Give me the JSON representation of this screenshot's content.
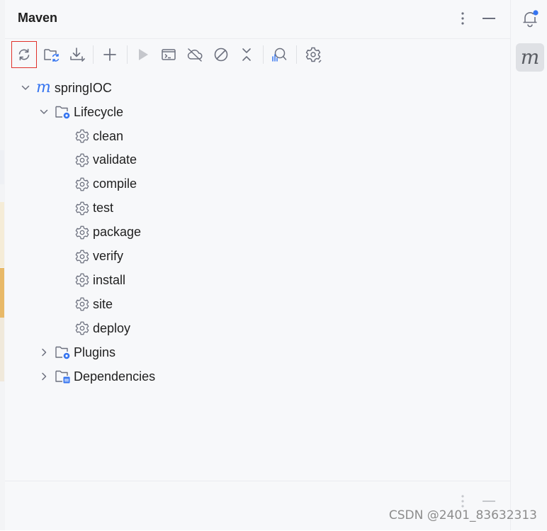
{
  "panel": {
    "title": "Maven"
  },
  "header": {
    "options_icon": "more-vertical-icon",
    "hide_icon": "minimize-icon"
  },
  "toolbar": {
    "buttons": [
      {
        "name": "reload-all-projects",
        "icon": "refresh-icon",
        "highlighted": true
      },
      {
        "name": "generate-sources",
        "icon": "folder-refresh-icon"
      },
      {
        "name": "download-sources",
        "icon": "download-icon"
      },
      {
        "name": "add-maven-project",
        "icon": "plus-icon"
      },
      {
        "name": "run-maven-build",
        "icon": "run-icon"
      },
      {
        "name": "execute-maven-goal",
        "icon": "terminal-icon"
      },
      {
        "name": "toggle-offline-mode",
        "icon": "offline-icon"
      },
      {
        "name": "skip-tests",
        "icon": "skip-icon"
      },
      {
        "name": "collapse-all",
        "icon": "collapse-icon"
      },
      {
        "name": "analyze-dependencies",
        "icon": "analyze-icon"
      },
      {
        "name": "build-tool-settings",
        "icon": "gear-icon"
      }
    ]
  },
  "tree": {
    "project": {
      "label": "springIOC",
      "logo": "m",
      "expanded": true
    },
    "lifecycle": {
      "label": "Lifecycle",
      "expanded": true,
      "goals": [
        "clean",
        "validate",
        "compile",
        "test",
        "package",
        "verify",
        "install",
        "site",
        "deploy"
      ]
    },
    "plugins": {
      "label": "Plugins",
      "expanded": false
    },
    "dependencies": {
      "label": "Dependencies",
      "expanded": false
    }
  },
  "right_bar": {
    "notifications_icon": "bell-icon",
    "maven_tool_label": "m"
  },
  "watermark": "CSDN @2401_83632313",
  "colors": {
    "accent": "#3574f0",
    "highlight_border": "#e0302a",
    "text": "#1f1f1f",
    "icon": "#6c707e"
  }
}
